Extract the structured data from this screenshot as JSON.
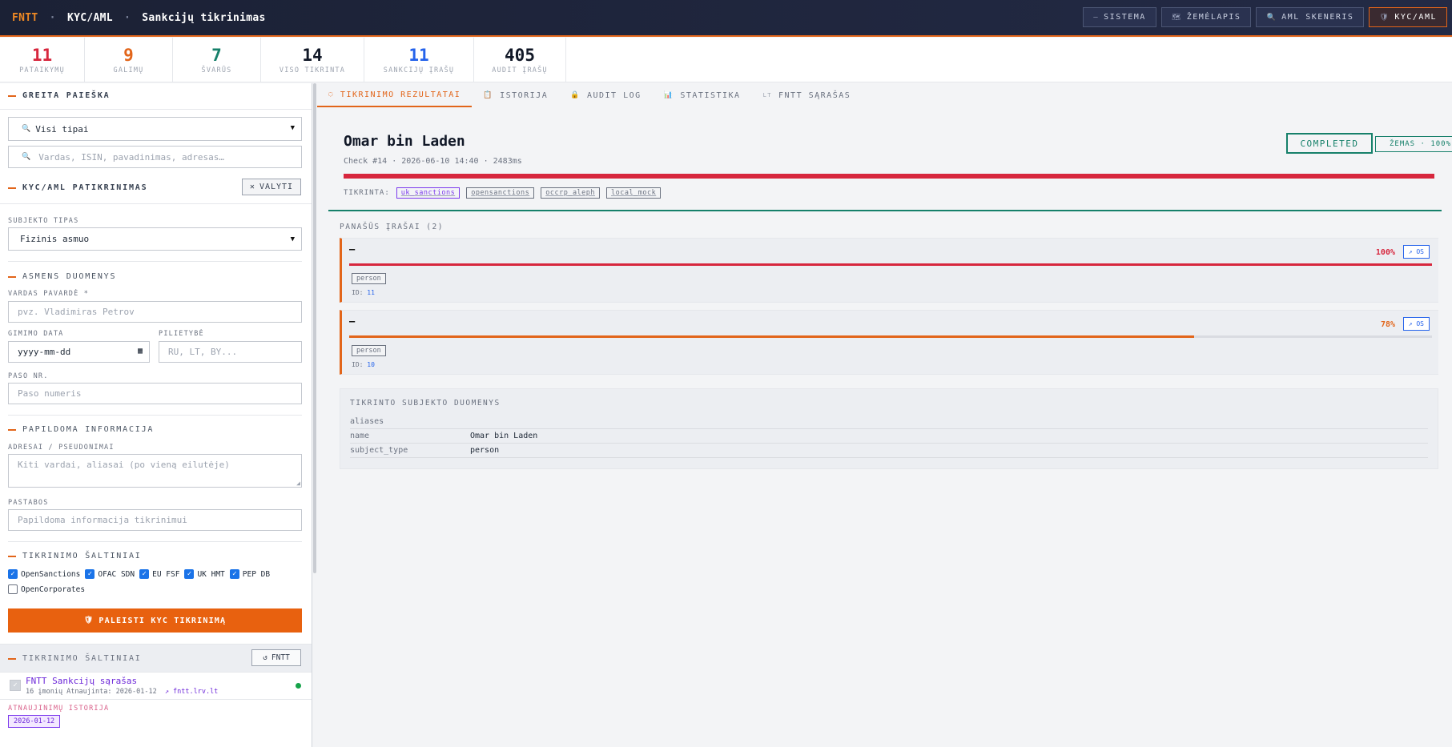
{
  "header": {
    "brand": "FNTT",
    "section": "KYC/AML",
    "page": "Sankcijų tikrinimas",
    "separator": "·",
    "nav": [
      {
        "label": "SISTEMA",
        "icon": "minus-icon",
        "glyph": "—"
      },
      {
        "label": "ŽEMĖLAPIS",
        "icon": "map-icon",
        "glyph": "🗺"
      },
      {
        "label": "AML SKENERIS",
        "icon": "search-icon",
        "glyph": "🔍"
      },
      {
        "label": "KYC/AML",
        "icon": "shield-icon",
        "glyph": "🛡"
      }
    ]
  },
  "stats": [
    {
      "value": "11",
      "label": "PATAIKYMŲ",
      "color": "#d7263d"
    },
    {
      "value": "9",
      "label": "GALIMŲ",
      "color": "#e2651a"
    },
    {
      "value": "7",
      "label": "ŠVARŪS",
      "color": "#16806a"
    },
    {
      "value": "14",
      "label": "VISO TIKRINTA",
      "color": "#111827"
    },
    {
      "value": "11",
      "label": "SANKCIJŲ ĮRAŠŲ",
      "color": "#2563eb"
    },
    {
      "value": "405",
      "label": "AUDIT ĮRAŠŲ",
      "color": "#111827"
    }
  ],
  "sidebar": {
    "quick_search": {
      "title": "GREITA PAIEŠKA",
      "type_select": "Visi tipai",
      "type_icon": "🔍",
      "search_placeholder": "Vardas, ISIN, pavadinimas, adresas…",
      "search_icon": "🔍"
    },
    "kyc": {
      "title": "KYC/AML PATIKRINIMAS",
      "clear_button": "VALYTI",
      "clear_icon": "✕",
      "subject_type_label": "SUBJEKTO TIPAS",
      "subject_type_value": "Fizinis asmuo",
      "person_section": "ASMENS DUOMENYS",
      "name_label": "VARDAS PAVARDĖ *",
      "name_placeholder": "pvz. Vladimiras Petrov",
      "dob_label": "GIMIMO DATA",
      "dob_placeholder": "yyyy-mm-dd",
      "nationality_label": "PILIETYBĖ",
      "nationality_placeholder": "RU, LT, BY...",
      "passport_label": "PASO NR.",
      "passport_placeholder": "Paso numeris",
      "extra_section": "PAPILDOMA INFORMACIJA",
      "aliases_label": "ADRESAI / PSEUDONIMAI",
      "aliases_placeholder": "Kiti vardai, aliasai (po vieną eilutėje)",
      "notes_label": "PASTABOS",
      "notes_placeholder": "Papildoma informacija tikrinimui",
      "sources_section": "TIKRINIMO ŠALTINIAI",
      "sources": [
        {
          "label": "OpenSanctions",
          "checked": true
        },
        {
          "label": "OFAC SDN",
          "checked": true
        },
        {
          "label": "EU FSF",
          "checked": true
        },
        {
          "label": "UK HMT",
          "checked": true
        },
        {
          "label": "PEP DB",
          "checked": true
        },
        {
          "label": "OpenCorporates",
          "checked": false
        }
      ],
      "run_button": "PALEISTI KYC TIKRINIMĄ",
      "run_icon": "🛡"
    },
    "source_list": {
      "title": "TIKRINIMO ŠALTINIAI",
      "refresh_button": "FNTT",
      "refresh_icon": "↺",
      "item_name": "FNTT Sankcijų sąrašas",
      "item_meta": "16 įmonių  Atnaujinta: 2026-01-12",
      "item_link": "↗ fntt.lrv.lt",
      "status_color": "#16a34a",
      "history_label": "ATNAUJINIMŲ ISTORIJA",
      "history_date": "2026-01-12"
    }
  },
  "tabs": [
    {
      "label": "TIKRINIMO REZULTATAI",
      "icon": "circle-icon",
      "glyph": "◌",
      "active": true
    },
    {
      "label": "ISTORIJA",
      "icon": "clipboard-icon",
      "glyph": "📋",
      "active": false
    },
    {
      "label": "AUDIT LOG",
      "icon": "lock-icon",
      "glyph": "🔒",
      "active": false
    },
    {
      "label": "STATISTIKA",
      "icon": "chart-icon",
      "glyph": "📊",
      "active": false
    },
    {
      "label": "FNTT SĄRAŠAS",
      "icon": "flag-icon",
      "glyph": "LT",
      "active": false
    }
  ],
  "result": {
    "name": "Omar bin Laden",
    "meta": "Check #14 · 2026-06-10 14:40 · 2483ms",
    "status": "COMPLETED",
    "risk": "ŽEMAS · 100%",
    "risk_level": 1.0,
    "checked_label": "TIKRINTA:",
    "checked_sources": [
      "uk_sanctions",
      "opensanctions",
      "occrp_aleph",
      "local_mock"
    ],
    "similar_title": "PANAŠŪS ĮRAŠAI (2)",
    "matches": [
      {
        "name": "—",
        "score": "100%",
        "score_value": 1.0,
        "color": "#d7263d",
        "type": "person",
        "id_label": "ID:",
        "id": "11",
        "link": "↗ OS"
      },
      {
        "name": "—",
        "score": "78%",
        "score_value": 0.78,
        "color": "#e2651a",
        "type": "person",
        "id_label": "ID:",
        "id": "10",
        "link": "↗ OS"
      }
    ],
    "subject_title": "TIKRINTO SUBJEKTO DUOMENYS",
    "subject_rows": [
      {
        "key": "aliases",
        "value": ""
      },
      {
        "key": "name",
        "value": "Omar bin Laden"
      },
      {
        "key": "subject_type",
        "value": "person"
      }
    ]
  }
}
